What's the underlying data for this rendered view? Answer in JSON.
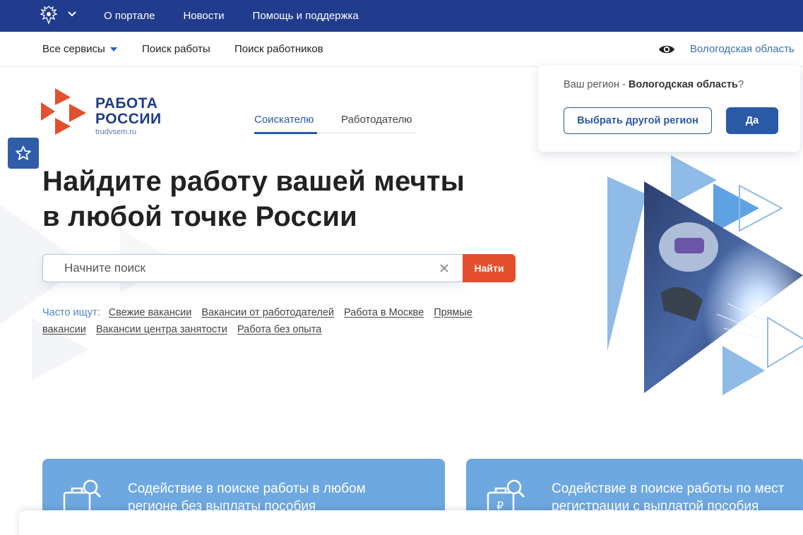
{
  "topbar": {
    "nav": [
      "О портале",
      "Новости",
      "Помощь и поддержка"
    ],
    "bg_color": "#213c8c",
    "emblem_icon": "coat-of-arms-icon"
  },
  "subnav": {
    "all_services": "Все сервисы",
    "find_job": "Поиск работы",
    "find_workers": "Поиск работников",
    "region": "Вологодская область"
  },
  "logo": {
    "line1": "РАБОТА",
    "line2": "РОССИИ",
    "url": "trudvsem.ru"
  },
  "tabs": {
    "seeker": "Соискателю",
    "employer": "Работодателю"
  },
  "hero": {
    "line1": "Найдите работу вашей мечты",
    "line2": "в любой точке России"
  },
  "search": {
    "placeholder": "Начните поиск",
    "button": "Найти"
  },
  "popular": {
    "label": "Часто ищут:",
    "links": [
      "Свежие вакансии",
      "Вакансии от работодателей",
      "Работа в Москве",
      "Прямые вакансии",
      "Вакансии центра занятости",
      "Работа без опыта"
    ]
  },
  "region_popup": {
    "question_prefix": "Ваш регион - ",
    "region_name": "Вологодская область",
    "question_suffix": "?",
    "other_button": "Выбрать другой регион",
    "yes_button": "Да"
  },
  "cards": [
    {
      "line1": "Содействие в поиске работы в любом",
      "line2": "регионе без выплаты пособия"
    },
    {
      "line1": "Содействие в поиске работы по мест",
      "line2": "регистрации с выплатой пособия"
    }
  ],
  "colors": {
    "brand_blue": "#2a5aa6",
    "accent_orange": "#e34f2d",
    "card_blue": "#6ea8e0"
  }
}
